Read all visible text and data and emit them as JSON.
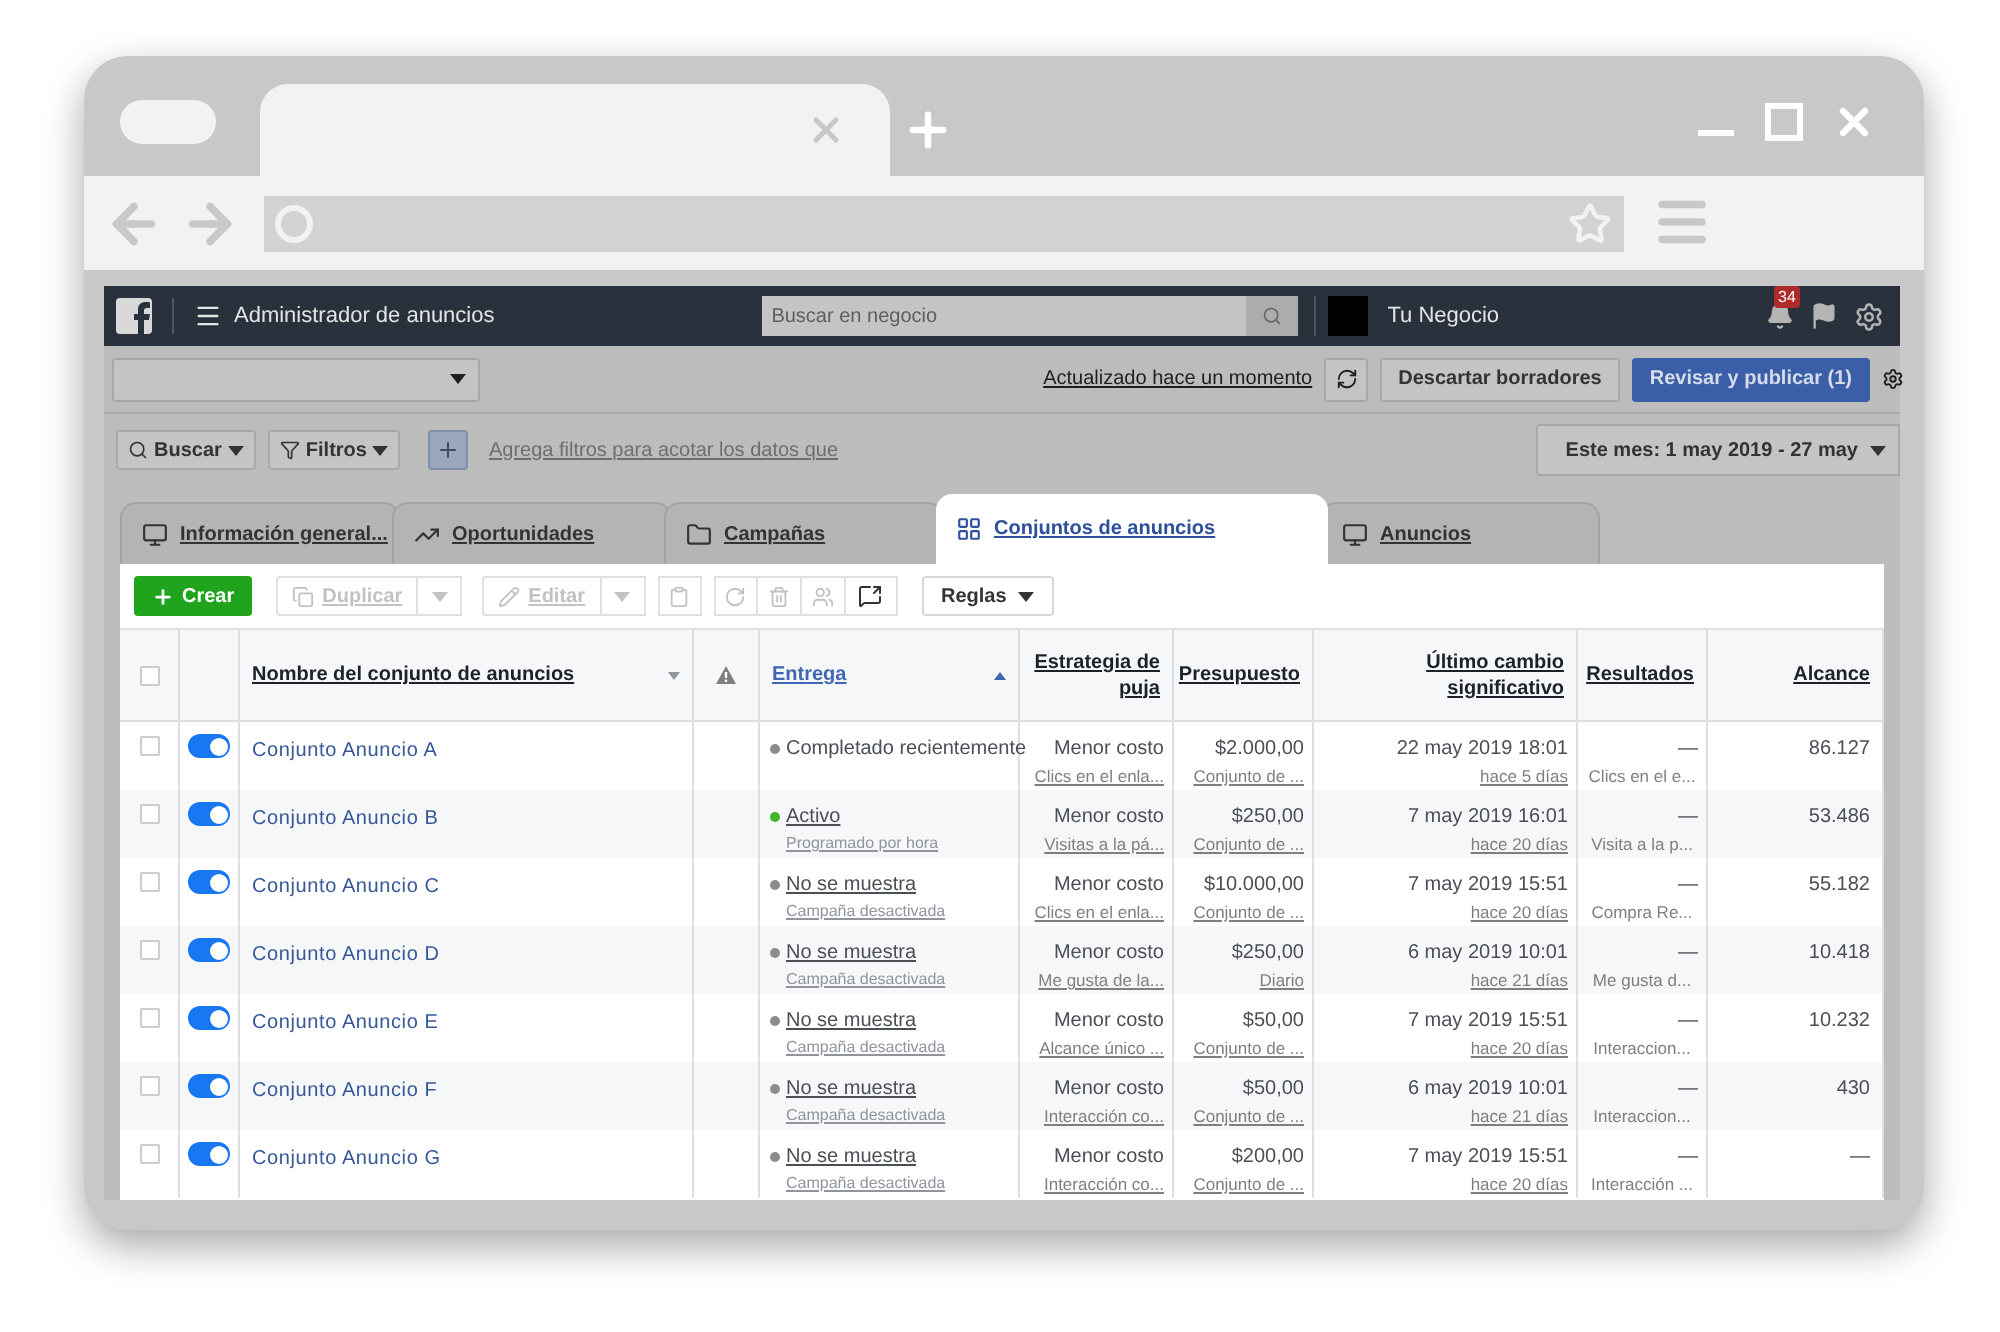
{
  "topbar": {
    "title": "Administrador de anuncios",
    "search_placeholder": "Buscar en negocio",
    "business": "Tu Negocio",
    "notifications": "34"
  },
  "actions": {
    "updated": "Actualizado hace un momento",
    "discard": "Descartar borradores",
    "publish": "Revisar y publicar (1)"
  },
  "filters": {
    "search": "Buscar",
    "filters": "Filtros",
    "hint": "Agrega filtros para acotar los datos que",
    "date": "Este mes: 1 may 2019 - 27 may"
  },
  "tabs": [
    {
      "label": "Información general...",
      "kind": "overview",
      "selected": false
    },
    {
      "label": "Oportunidades",
      "kind": "trend",
      "selected": false
    },
    {
      "label": "Campañas",
      "kind": "folder",
      "selected": false
    },
    {
      "label": "Conjuntos de anuncios",
      "kind": "grid",
      "selected": true
    },
    {
      "label": "Anuncios",
      "kind": "ad",
      "selected": false
    }
  ],
  "toolbar": {
    "create": "Crear",
    "duplicate": "Duplicar",
    "edit": "Editar",
    "rules": "Reglas"
  },
  "select_all": {
    "checked": false
  },
  "columns": [
    {
      "label": "Nombre del conjunto de anuncios",
      "sorted": false
    },
    {
      "label": "Entrega",
      "sorted": true
    },
    {
      "label": "Estrategia de puja"
    },
    {
      "label": "Presupuesto"
    },
    {
      "label": "Último cambio significativo"
    },
    {
      "label": "Resultados"
    },
    {
      "label": "Alcance"
    }
  ],
  "rows": [
    {
      "checked": false,
      "on": true,
      "name": "Conjunto Anuncio A",
      "delivery": "Completado recientemente",
      "color": "#8d8d8d",
      "delivery_sub": null,
      "bid": "Menor costo",
      "bid_sub": "Clics en el enla...",
      "budget": "$2.000,00",
      "budget_sub": "Conjunto de ...",
      "changed": "22 may 2019 18:01",
      "changed_sub": "hace 5 días",
      "results": "—",
      "results_sub": "Clics en el e...",
      "reach": "86.127"
    },
    {
      "checked": false,
      "on": true,
      "name": "Conjunto Anuncio B",
      "delivery": "Activo",
      "color": "#42b72a",
      "delivery_sub": "Programado por hora",
      "bid": "Menor costo",
      "bid_sub": "Visitas a la pá...",
      "budget": "$250,00",
      "budget_sub": "Conjunto de ...",
      "changed": "7 may 2019 16:01",
      "changed_sub": "hace 20 días",
      "results": "—",
      "results_sub": "Visita a la p...",
      "reach": "53.486"
    },
    {
      "checked": false,
      "on": true,
      "name": "Conjunto Anuncio C",
      "delivery": "No se muestra",
      "color": "#8d8d8d",
      "delivery_sub": "Campaña desactivada",
      "bid": "Menor costo",
      "bid_sub": "Clics en el enla...",
      "budget": "$10.000,00",
      "budget_sub": "Conjunto de ...",
      "changed": "7 may 2019 15:51",
      "changed_sub": "hace 20 días",
      "results": "—",
      "results_sub": "Compra Re...",
      "reach": "55.182"
    },
    {
      "checked": false,
      "on": true,
      "name": "Conjunto Anuncio D",
      "delivery": "No se muestra",
      "color": "#8d8d8d",
      "delivery_sub": "Campaña desactivada",
      "bid": "Menor costo",
      "bid_sub": "Me gusta de la...",
      "budget": "$250,00",
      "budget_sub": "Diario",
      "changed": "6 may 2019 10:01",
      "changed_sub": "hace 21 días",
      "results": "—",
      "results_sub": "Me gusta d...",
      "reach": "10.418"
    },
    {
      "checked": false,
      "on": true,
      "name": "Conjunto Anuncio E",
      "delivery": "No se muestra",
      "color": "#8d8d8d",
      "delivery_sub": "Campaña desactivada",
      "bid": "Menor costo",
      "bid_sub": "Alcance único ...",
      "budget": "$50,00",
      "budget_sub": "Conjunto de ...",
      "changed": "7 may 2019 15:51",
      "changed_sub": "hace 20 días",
      "results": "—",
      "results_sub": "Interaccion...",
      "reach": "10.232"
    },
    {
      "checked": false,
      "on": true,
      "name": "Conjunto Anuncio F",
      "delivery": "No se muestra",
      "color": "#8d8d8d",
      "delivery_sub": "Campaña desactivada",
      "bid": "Menor costo",
      "bid_sub": "Interacción co...",
      "budget": "$50,00",
      "budget_sub": "Conjunto de ...",
      "changed": "6 may 2019 10:01",
      "changed_sub": "hace 21 días",
      "results": "—",
      "results_sub": "Interaccion...",
      "reach": "430"
    },
    {
      "checked": false,
      "on": true,
      "name": "Conjunto Anuncio G",
      "delivery": "No se muestra",
      "color": "#8d8d8d",
      "delivery_sub": "Campaña desactivada",
      "bid": "Menor costo",
      "bid_sub": "Interacción co...",
      "budget": "$200,00",
      "budget_sub": "Conjunto de ...",
      "changed": "7 may 2019 15:51",
      "changed_sub": "hace 20 días",
      "results": "—",
      "results_sub": "Interacción ...",
      "reach": "—"
    }
  ]
}
